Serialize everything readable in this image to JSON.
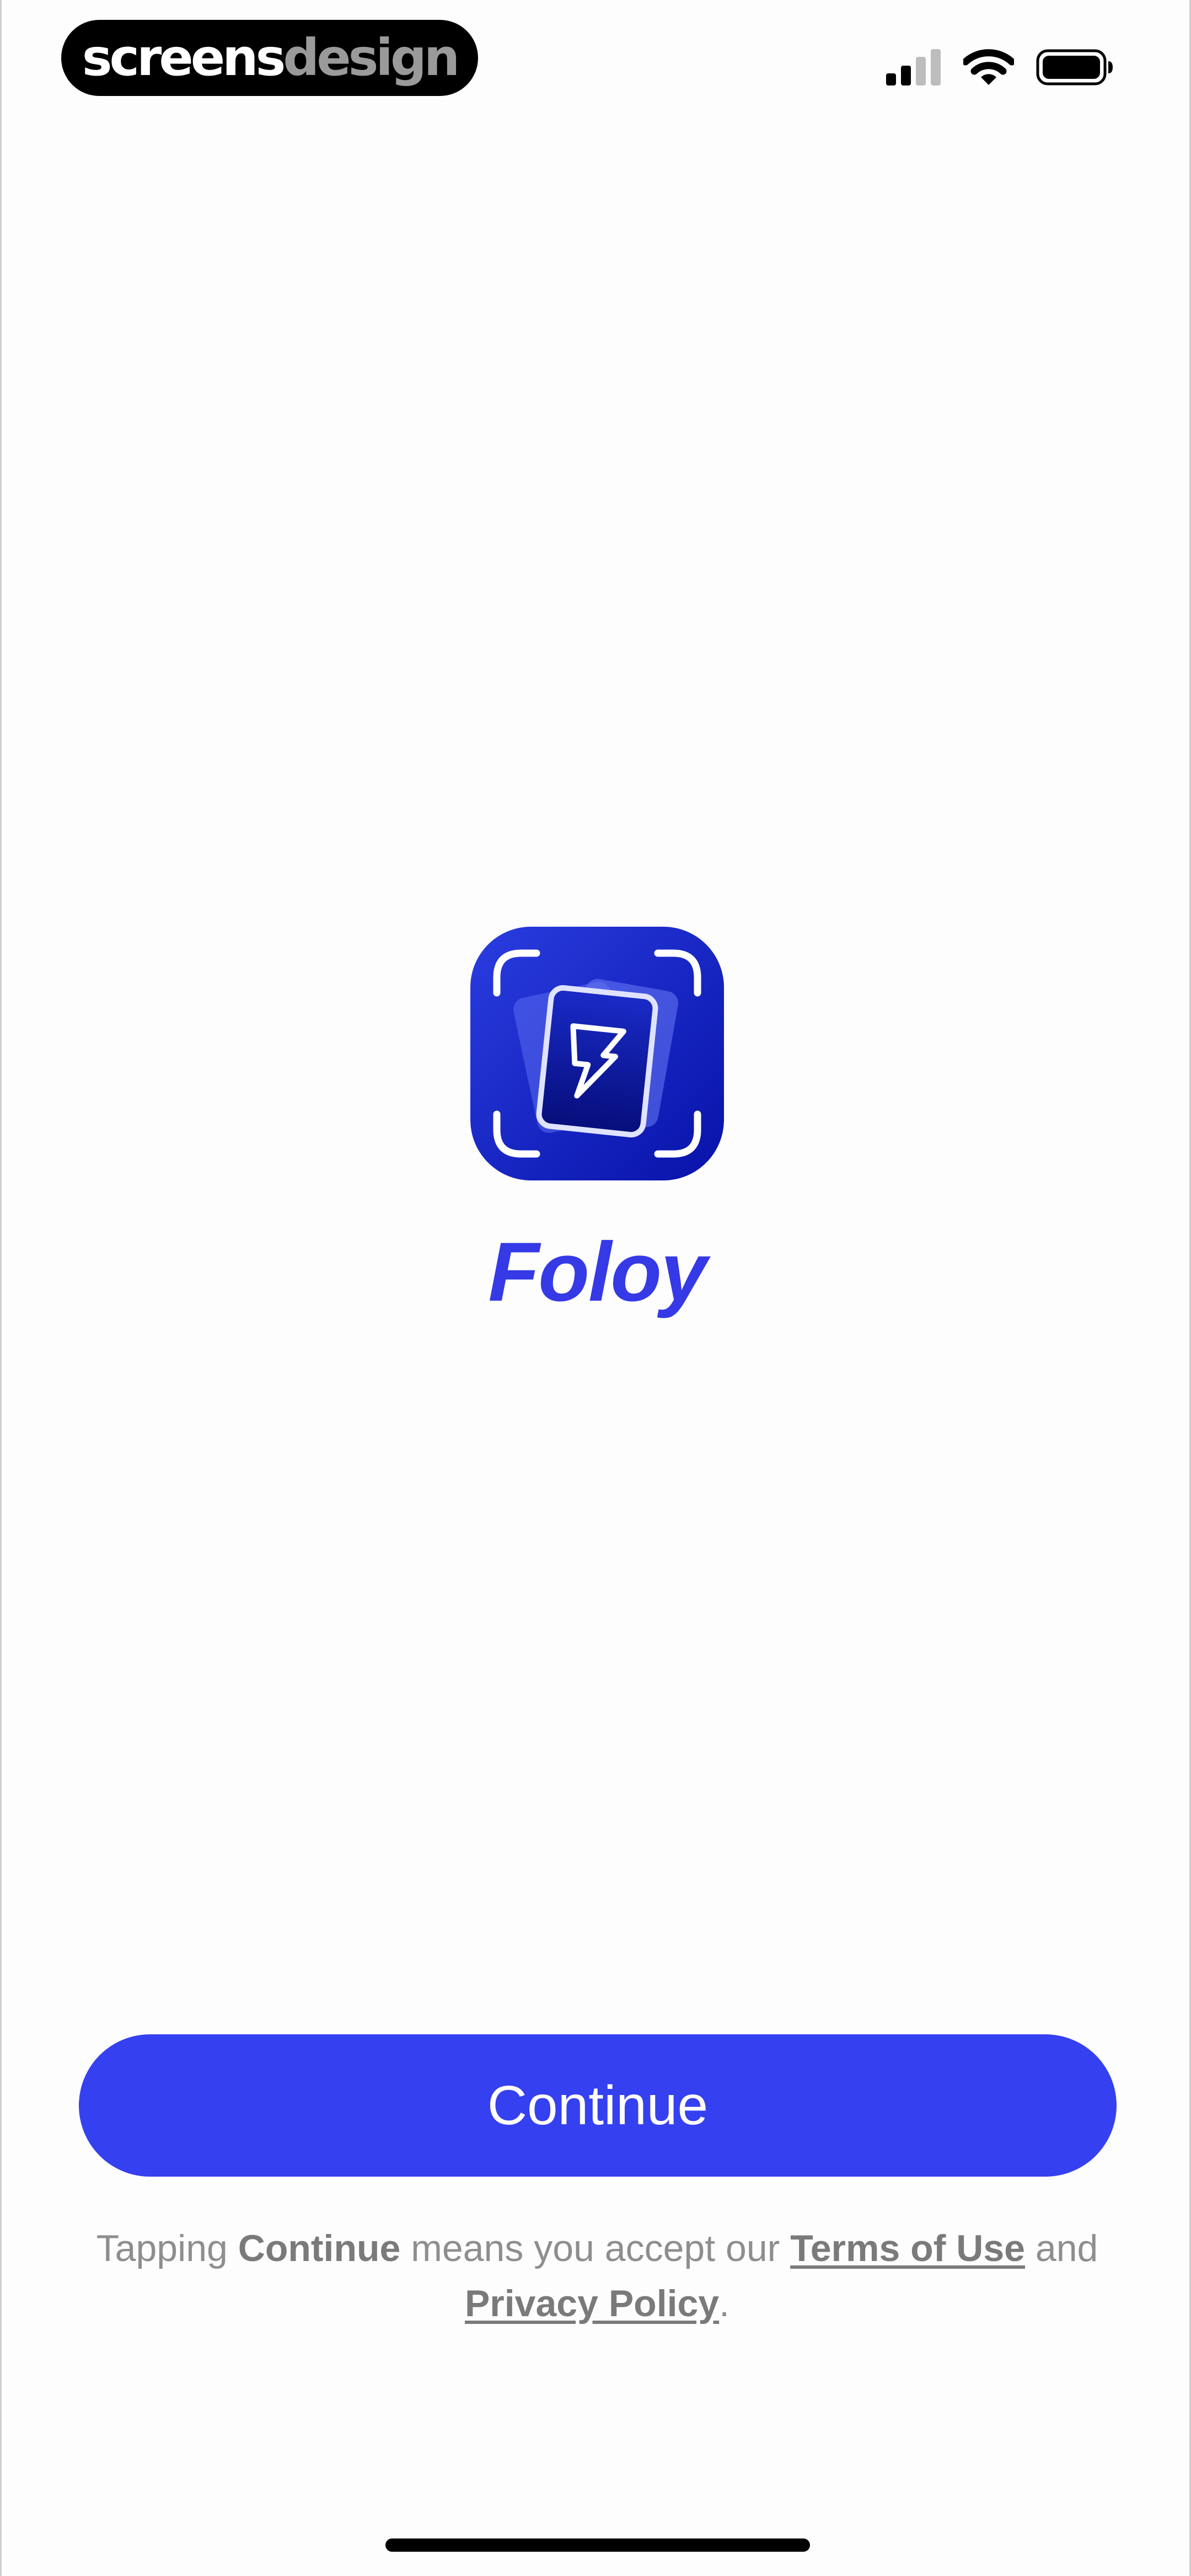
{
  "status_bar": {
    "brand_primary": "screens",
    "brand_secondary": "design",
    "signal_icon": "cellular-signal-icon",
    "wifi_icon": "wifi-icon",
    "battery_icon": "battery-icon"
  },
  "app": {
    "name": "Foloy",
    "icon": "card-scan-app-icon",
    "brand_color": "#3539e6"
  },
  "continue_button": {
    "label": "Continue",
    "color": "#3540f0"
  },
  "legal": {
    "prefix": "Tapping",
    "continue_word": "Continue",
    "middle": "means you accept our",
    "terms_label": "Terms of Use",
    "and_word": "and",
    "privacy_label": "Privacy Policy",
    "suffix": "."
  }
}
